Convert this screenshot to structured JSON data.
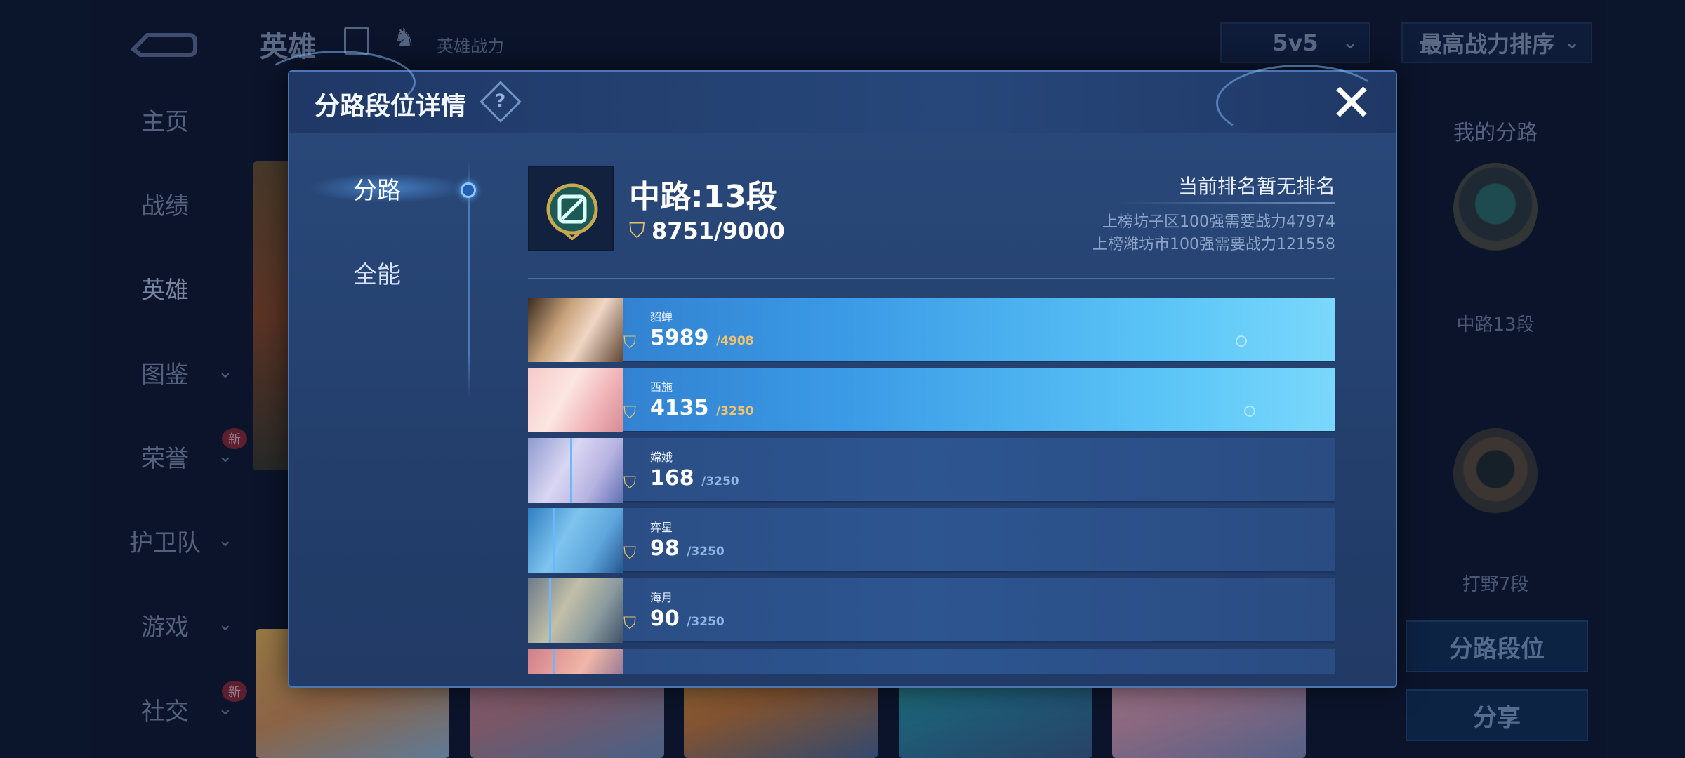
{
  "background": {
    "page_title": "英雄",
    "hero_power_label": "英雄战力",
    "mode_select": "5v5",
    "sort_select": "最高战力排序",
    "nav": [
      {
        "label": "主页"
      },
      {
        "label": "战绩"
      },
      {
        "label": "英雄"
      },
      {
        "label": "图鉴"
      },
      {
        "label": "荣誉"
      },
      {
        "label": "护卫队"
      },
      {
        "label": "游戏"
      },
      {
        "label": "社交"
      }
    ],
    "new_badge": "新",
    "right_panel": {
      "title": "我的分路",
      "lane_label_1": "中路13段",
      "lane_label_2": "打野7段",
      "lane_rank_button": "分路段位",
      "share_button": "分享"
    }
  },
  "modal": {
    "title": "分路段位详情",
    "help": "?",
    "close": "✕",
    "tabs": [
      {
        "label": "分路"
      },
      {
        "label": "全能"
      }
    ],
    "lane": {
      "title": "中路:13段",
      "power": "8751/9000",
      "rank_status": "当前排名暂无排名",
      "requirement_district": "上榜坊子区100强需要战力47974",
      "requirement_city": "上榜潍坊市100强需要战力121558"
    },
    "heroes": [
      {
        "name": "貂蝉",
        "score": "5989",
        "max": "/4908"
      },
      {
        "name": "西施",
        "score": "4135",
        "max": "/3250"
      },
      {
        "name": "嫦娥",
        "score": "168",
        "max": "/3250"
      },
      {
        "name": "弈星",
        "score": "98",
        "max": "/3250"
      },
      {
        "name": "海月",
        "score": "90",
        "max": "/3250"
      }
    ]
  },
  "colors": {
    "accent": "#4a77b3",
    "highlight_row": "#5cc6f7",
    "power_gold": "#e7c36a"
  },
  "icons": {
    "back": "back-arrow-icon",
    "list": "list-icon",
    "help": "question-diamond-icon",
    "close": "close-icon",
    "power": "power-badge-icon",
    "mid_lane": "mid-lane-badge-icon"
  }
}
